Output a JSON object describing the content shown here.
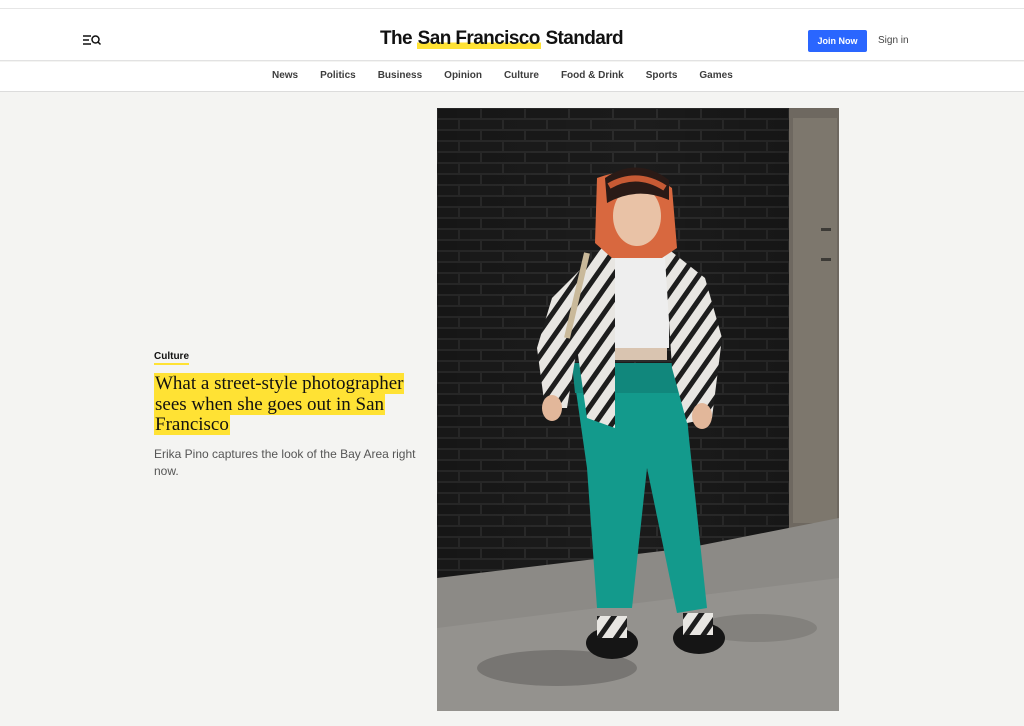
{
  "header": {
    "logo_prefix": "The ",
    "logo_highlight": "San Francisco",
    "logo_suffix": " Standard",
    "join_label": "Join Now",
    "signin_label": "Sign in"
  },
  "nav": {
    "items": [
      "News",
      "Politics",
      "Business",
      "Opinion",
      "Culture",
      "Food & Drink",
      "Sports",
      "Games"
    ]
  },
  "article": {
    "kicker": "Culture",
    "headline": "What a street-style photographer sees when she goes out in San Francisco",
    "dek": "Erika Pino captures the look of the Bay Area right now."
  },
  "colors": {
    "accent_yellow": "#ffe234",
    "button_blue": "#2a66ff",
    "page_bg": "#f4f4f2"
  },
  "icons": {
    "menu": "menu-search-icon"
  }
}
